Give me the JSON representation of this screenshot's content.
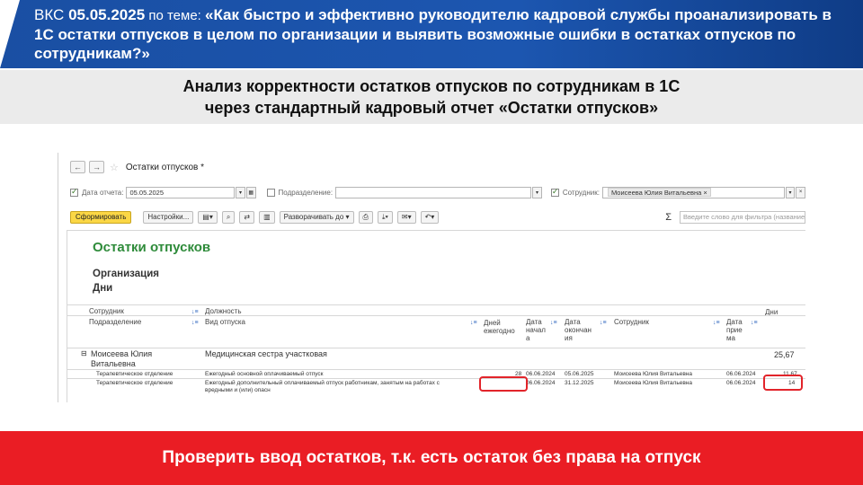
{
  "banner": {
    "prefix": "ВКС ",
    "date": "05.05.2025",
    "middle": " по теме: ",
    "topic": "«Как быстро и эффективно руководителю кадровой службы проанализировать в 1С остатки отпусков в целом по организации и выявить возможные ошибки в остатках отпусков по сотрудникам?»"
  },
  "subtitle": {
    "line1": "Анализ корректности остатков отпусков по сотрудникам в 1С",
    "line2": "через стандартный кадровый отчет «Остатки отпусков»"
  },
  "window": {
    "title": "Остатки отпусков *",
    "params": {
      "date_label": "Дата отчета:",
      "date_value": "05.05.2025",
      "dept_label": "Подразделение:",
      "dept_value": "",
      "employee_label": "Сотрудник:",
      "employee_value": "Моисеева Юлия Витальевна"
    },
    "toolbar": {
      "generate": "Сформировать",
      "settings": "Настройки...",
      "expand": "Разворачивать до",
      "filter_placeholder": "Введите слово для фильтра (название товара"
    }
  },
  "report": {
    "title": "Остатки отпусков",
    "group1": "Организация",
    "group2": "Дни",
    "headers": {
      "employee": "Сотрудник",
      "position": "Должность",
      "days": "Дни",
      "department": "Подразделение",
      "vacation_type": "Вид отпуска",
      "annual_days_1": "Дней",
      "annual_days_2": "ежегодно",
      "start_1": "Дата",
      "start_2": "начал",
      "start_3": "а",
      "end_1": "Дата",
      "end_2": "окончан",
      "end_3": "ия",
      "employee2": "Сотрудник",
      "hire_1": "Дата",
      "hire_2": "прие",
      "hire_3": "ма"
    },
    "group_row": {
      "name_1": "Моисеева Юлия",
      "name_2": "Витальевна",
      "position": "Медицинская сестра участковая",
      "total": "25,67"
    },
    "rows": [
      {
        "department": "Терапевтическое отделение",
        "type": "Ежегодный основной оплачиваемый отпуск",
        "annual": "28",
        "start": "06.06.2024",
        "end": "05.06.2025",
        "employee": "Моисеева Юлия Витальевна",
        "hire": "06.06.2024",
        "days": "11,67"
      },
      {
        "department": "Терапевтическое отделение",
        "type_1": "Ежегодный дополнительный оплачиваемый отпуск работникам, занятым на работах с",
        "type_2": "вредными и (или) опасн",
        "annual": "",
        "start": "06.06.2024",
        "end": "31.12.2025",
        "employee": "Моисеева Юлия Витальевна",
        "hire": "06.06.2024",
        "days": "14"
      }
    ]
  },
  "footer": "Проверить ввод остатков, т.к. есть остаток без права на отпуск",
  "colors": {
    "banner_blue": "#1c56b0",
    "footer_red": "#ea1d24",
    "report_title_green": "#2e8b3a",
    "generate_yellow": "#fbd745",
    "highlight_red": "#e2242a"
  }
}
